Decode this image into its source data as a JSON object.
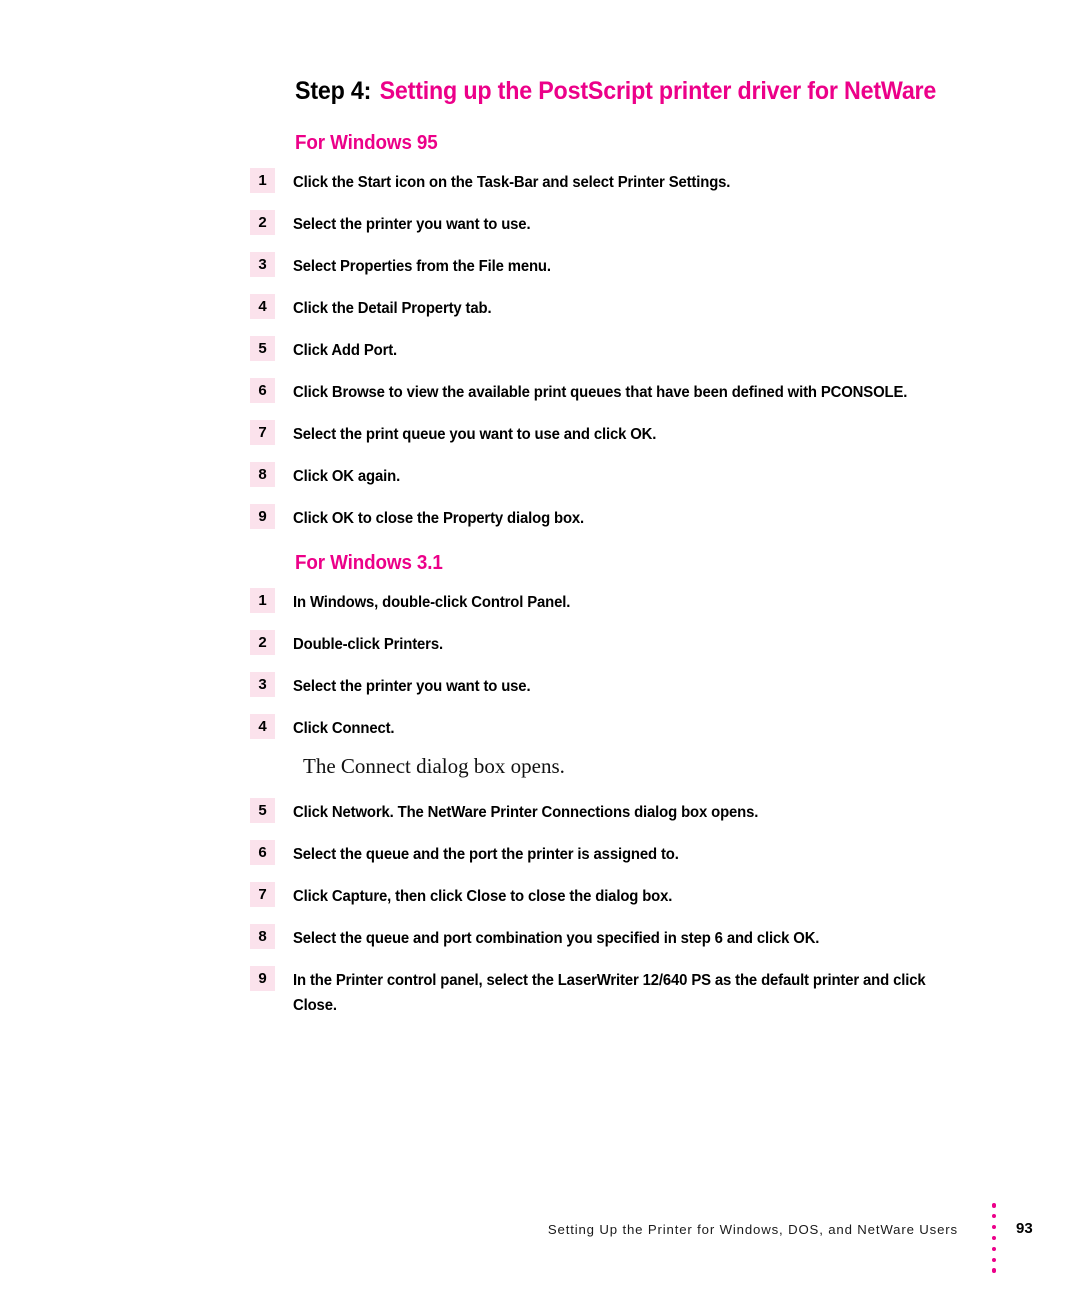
{
  "colors": {
    "magenta": "#EC0089",
    "badge_bg": "#FBE2EC",
    "text": "#000000"
  },
  "heading": {
    "step_label": "Step 4:",
    "step_title": "Setting up the PostScript printer driver for NetWare"
  },
  "sections": [
    {
      "subheading": "For Windows 95",
      "steps": [
        {
          "num": "1",
          "text": "Click the Start icon on the Task-Bar and select Printer Settings."
        },
        {
          "num": "2",
          "text": "Select the printer you want to use."
        },
        {
          "num": "3",
          "text": "Select Properties from the File menu."
        },
        {
          "num": "4",
          "text": "Click the Detail Property tab."
        },
        {
          "num": "5",
          "text": "Click Add Port."
        },
        {
          "num": "6",
          "text": "Click Browse to view the available print queues that have been defined with PCONSOLE."
        },
        {
          "num": "7",
          "text": "Select the print queue you want to use and click OK."
        },
        {
          "num": "8",
          "text": "Click OK again."
        },
        {
          "num": "9",
          "text": "Click OK to close the Property dialog box."
        }
      ]
    },
    {
      "subheading": "For Windows 3.1",
      "steps": [
        {
          "num": "1",
          "text": "In Windows, double-click Control Panel."
        },
        {
          "num": "2",
          "text": "Double-click Printers."
        },
        {
          "num": "3",
          "text": "Select the printer you want to use."
        },
        {
          "num": "4",
          "text": "Click Connect."
        }
      ]
    }
  ],
  "note": "The Connect dialog box opens.",
  "sections_continued": {
    "steps": [
      {
        "num": "5",
        "text": "Click Network. The NetWare Printer Connections dialog box opens."
      },
      {
        "num": "6",
        "text": "Select the queue and the port the printer is assigned to."
      },
      {
        "num": "7",
        "text": "Click Capture, then click Close to close the dialog box."
      },
      {
        "num": "8",
        "text": "Select the queue and port combination you specified in step 6 and click OK."
      },
      {
        "num": "9",
        "text": "In the Printer control panel, select the LaserWriter 12/640 PS as the default printer and click Close."
      }
    ]
  },
  "footer": {
    "running_head": "Setting Up the Printer for Windows, DOS, and NetWare Users",
    "page_number": "93"
  }
}
